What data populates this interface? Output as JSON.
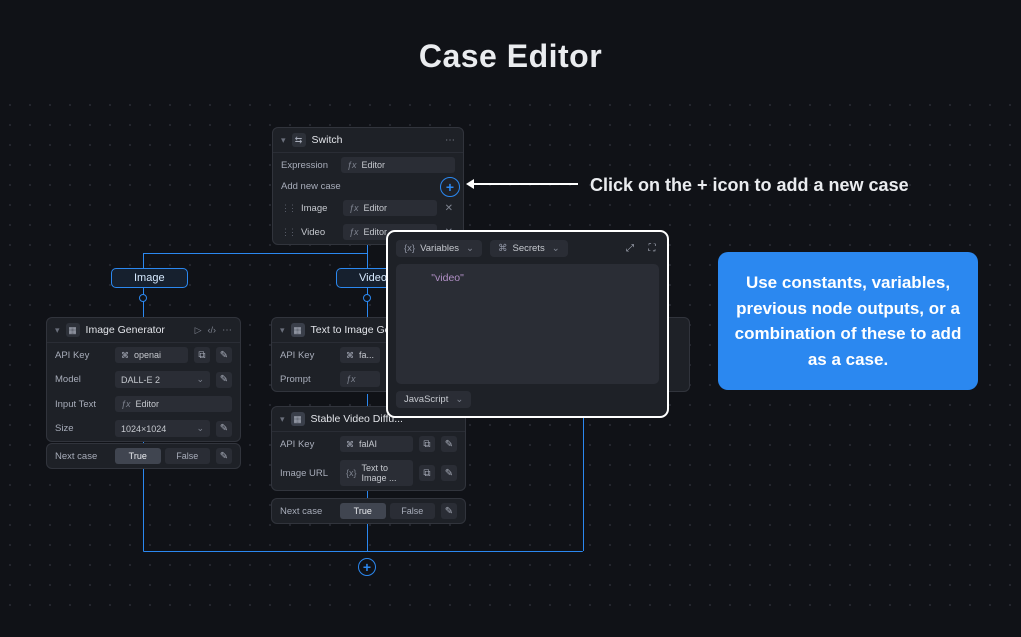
{
  "title": "Case Editor",
  "annotation_text": "Click on the + icon to add a new case",
  "tip_text": "Use constants, variables, previous node outputs, or a combination of these to add as a case.",
  "switch_node": {
    "name": "Switch",
    "expression_label": "Expression",
    "expression_value": "Editor",
    "add_new_case_label": "Add new case",
    "cases": [
      {
        "name": "Image",
        "value": "Editor"
      },
      {
        "name": "Video",
        "value": "Editor"
      }
    ]
  },
  "branches": {
    "image": "Image",
    "video": "Video"
  },
  "image_generator": {
    "name": "Image Generator",
    "api_key_label": "API Key",
    "api_key_value": "openai",
    "model_label": "Model",
    "model_value": "DALL-E 2",
    "input_text_label": "Input Text",
    "input_text_value": "Editor",
    "size_label": "Size",
    "size_value": "1024×1024"
  },
  "text_to_image": {
    "name": "Text to Image Gen...",
    "api_key_label": "API Key",
    "api_key_value": "fa...",
    "prompt_label": "Prompt"
  },
  "stable_video": {
    "name": "Stable Video Diffu...",
    "api_key_label": "API Key",
    "api_key_value": "falAI",
    "image_url_label": "Image URL",
    "image_url_value": "Text to Image ..."
  },
  "next_case": {
    "label": "Next case",
    "true": "True",
    "false": "False"
  },
  "expr_popup": {
    "variables_label": "Variables",
    "secrets_label": "Secrets",
    "body": "\"video\"",
    "lang": "JavaScript"
  }
}
